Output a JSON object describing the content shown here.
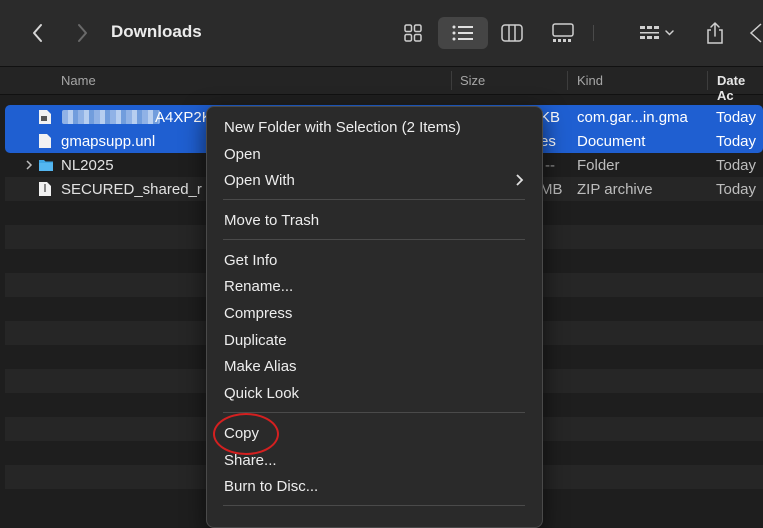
{
  "window": {
    "title": "Downloads"
  },
  "toolbar": {
    "icons": [
      "back-icon",
      "forward-icon",
      "grid-view-icon",
      "list-view-icon",
      "column-view-icon",
      "gallery-view-icon",
      "group-icon",
      "share-icon",
      "tag-icon"
    ]
  },
  "columns": {
    "name": "Name",
    "size": "Size",
    "kind": "Kind",
    "date": "Date Ac"
  },
  "files": [
    {
      "name": "A4XP2K",
      "size": "KB",
      "kind": "com.gar...in.gma",
      "date": "Today",
      "selected": true,
      "icon": "file-icon"
    },
    {
      "name": "gmapsupp.unl",
      "size": "es",
      "kind": "Document",
      "date": "Today",
      "selected": true,
      "icon": "document-icon"
    },
    {
      "name": "NL2025",
      "size": "--",
      "kind": "Folder",
      "date": "Today",
      "selected": false,
      "icon": "folder-icon"
    },
    {
      "name": "SECURED_shared_r",
      "size": "MB",
      "kind": "ZIP archive",
      "date": "Today",
      "selected": false,
      "icon": "zip-icon"
    }
  ],
  "context_menu": {
    "items": [
      "New Folder with Selection (2 Items)",
      "Open",
      "Open With",
      "Move to Trash",
      "Get Info",
      "Rename...",
      "Compress",
      "Duplicate",
      "Make Alias",
      "Quick Look",
      "Copy",
      "Share...",
      "Burn to Disc..."
    ]
  },
  "colors": {
    "selection": "#1f5fd1",
    "highlight_circle": "#d42020"
  }
}
